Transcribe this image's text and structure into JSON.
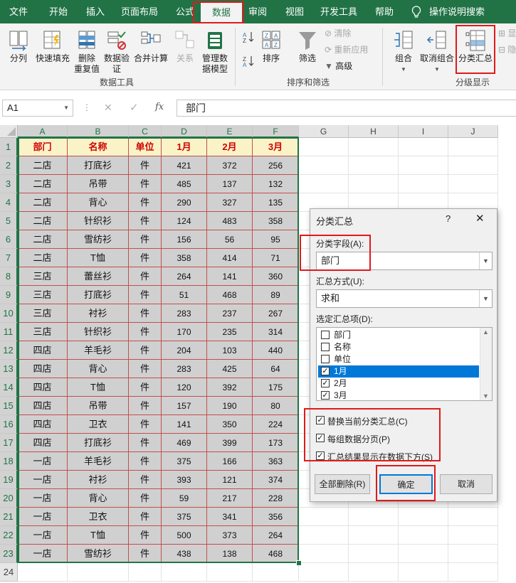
{
  "tabs": [
    "文件",
    "开始",
    "插入",
    "页面布局",
    "公式",
    "数据",
    "审阅",
    "视图",
    "开发工具",
    "帮助",
    "操作说明搜索"
  ],
  "ribbon": {
    "data_tools": {
      "split": "分列",
      "flash_fill": "快速填充",
      "remove_dup_1": "删除",
      "remove_dup_2": "重复值",
      "validation_1": "数据验",
      "validation_2": "证",
      "consolidate": "合并计算",
      "relations": "关系",
      "data_model_1": "管理数",
      "data_model_2": "据模型",
      "group_label": "数据工具"
    },
    "sort_filter": {
      "sort": "排序",
      "filter": "筛选",
      "clear": "清除",
      "reapply": "重新应用",
      "advanced": "高级",
      "group_label": "排序和筛选"
    },
    "outline": {
      "group": "组合",
      "ungroup": "取消组合",
      "subtotal": "分类汇总",
      "group_label": "分级显示",
      "show": "显",
      "hide": "隐"
    }
  },
  "formula_bar": {
    "name_box": "A1",
    "fx": "fx",
    "content": "部门"
  },
  "columns": [
    "A",
    "B",
    "C",
    "D",
    "E",
    "F",
    "G",
    "H",
    "I",
    "J"
  ],
  "rows": [
    "1",
    "2",
    "3",
    "4",
    "5",
    "6",
    "7",
    "8",
    "9",
    "10",
    "11",
    "12",
    "13",
    "14",
    "15",
    "16",
    "17",
    "18",
    "19",
    "20",
    "21",
    "22",
    "23",
    "24"
  ],
  "table": {
    "headers": [
      "部门",
      "名称",
      "单位",
      "1月",
      "2月",
      "3月"
    ],
    "rows": [
      [
        "二店",
        "打底衫",
        "件",
        "421",
        "372",
        "256"
      ],
      [
        "二店",
        "吊带",
        "件",
        "485",
        "137",
        "132"
      ],
      [
        "二店",
        "背心",
        "件",
        "290",
        "327",
        "135"
      ],
      [
        "二店",
        "针织衫",
        "件",
        "124",
        "483",
        "358"
      ],
      [
        "二店",
        "雪纺衫",
        "件",
        "156",
        "56",
        "95"
      ],
      [
        "二店",
        "T恤",
        "件",
        "358",
        "414",
        "71"
      ],
      [
        "三店",
        "蕾丝衫",
        "件",
        "264",
        "141",
        "360"
      ],
      [
        "三店",
        "打底衫",
        "件",
        "51",
        "468",
        "89"
      ],
      [
        "三店",
        "衬衫",
        "件",
        "283",
        "237",
        "267"
      ],
      [
        "三店",
        "针织衫",
        "件",
        "170",
        "235",
        "314"
      ],
      [
        "四店",
        "羊毛衫",
        "件",
        "204",
        "103",
        "440"
      ],
      [
        "四店",
        "背心",
        "件",
        "283",
        "425",
        "64"
      ],
      [
        "四店",
        "T恤",
        "件",
        "120",
        "392",
        "175"
      ],
      [
        "四店",
        "吊带",
        "件",
        "157",
        "190",
        "80"
      ],
      [
        "四店",
        "卫衣",
        "件",
        "141",
        "350",
        "224"
      ],
      [
        "四店",
        "打底衫",
        "件",
        "469",
        "399",
        "173"
      ],
      [
        "一店",
        "羊毛衫",
        "件",
        "375",
        "166",
        "363"
      ],
      [
        "一店",
        "衬衫",
        "件",
        "393",
        "121",
        "374"
      ],
      [
        "一店",
        "背心",
        "件",
        "59",
        "217",
        "228"
      ],
      [
        "一店",
        "卫衣",
        "件",
        "375",
        "341",
        "356"
      ],
      [
        "一店",
        "T恤",
        "件",
        "500",
        "373",
        "264"
      ],
      [
        "一店",
        "雪纺衫",
        "件",
        "438",
        "138",
        "468"
      ]
    ]
  },
  "dialog": {
    "title": "分类汇总",
    "help": "?",
    "close": "✕",
    "field_label": "分类字段(A):",
    "field_value": "部门",
    "func_label": "汇总方式(U):",
    "func_value": "求和",
    "items_label": "选定汇总项(D):",
    "items": [
      {
        "label": "部门",
        "checked": false
      },
      {
        "label": "名称",
        "checked": false
      },
      {
        "label": "单位",
        "checked": false
      },
      {
        "label": "1月",
        "checked": true
      },
      {
        "label": "2月",
        "checked": true
      },
      {
        "label": "3月",
        "checked": true
      }
    ],
    "replace_current": "替换当前分类汇总(C)",
    "page_break": "每组数据分页(P)",
    "summary_below": "汇总结果显示在数据下方(S)",
    "remove_all": "全部删除(R)",
    "ok": "确定",
    "cancel": "取消"
  },
  "colors": {
    "excel_green": "#217346",
    "highlight_red": "#e01a1a",
    "header_fill": "#fbf3c8",
    "data_fill": "#d0d0d0",
    "selection_blue": "#0078d7"
  }
}
